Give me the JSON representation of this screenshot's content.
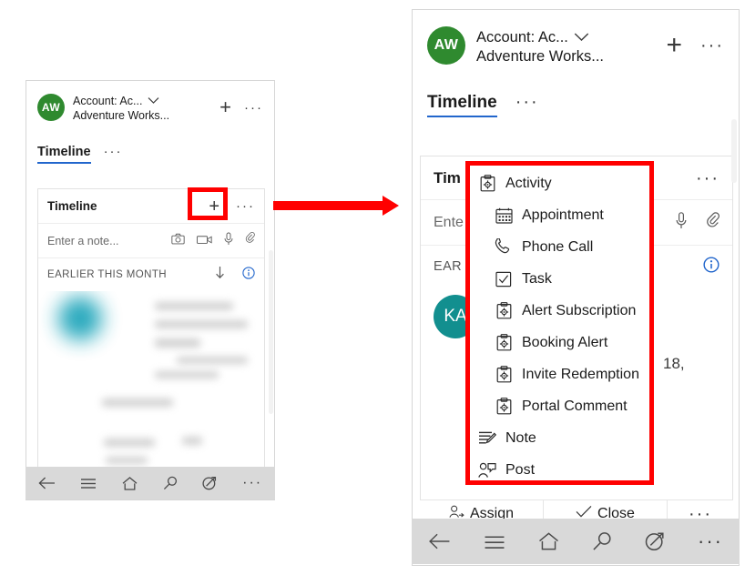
{
  "left_panel": {
    "account": {
      "avatar_initials": "AW",
      "title": "Account: Ac...",
      "subtitle": "Adventure Works...",
      "chevron": "chevron-down",
      "add_label": "+",
      "more_label": "···"
    },
    "tab": {
      "label": "Timeline",
      "more_label": "···"
    },
    "card": {
      "title": "Timeline",
      "add_label": "+",
      "more_label": "···",
      "note_placeholder": "Enter a note...",
      "note_icons": [
        "camera-icon",
        "video-icon",
        "microphone-icon",
        "attachment-icon"
      ],
      "section_label": "EARLIER THIS MONTH",
      "sort_icon": "arrow-down-icon",
      "info_icon": "info-icon"
    },
    "nav": {
      "items": [
        "back-icon",
        "menu-icon",
        "home-icon",
        "search-icon",
        "compass-icon",
        "more-icon"
      ]
    }
  },
  "right_panel": {
    "account": {
      "avatar_initials": "AW",
      "title": "Account: Ac...",
      "subtitle": "Adventure Works...",
      "chevron": "chevron-down",
      "add_label": "+",
      "more_label": "···"
    },
    "tab": {
      "label": "Timeline",
      "more_label": "···"
    },
    "card": {
      "title": "Tim",
      "more_label": "···",
      "note_placeholder": "Ente",
      "section_label": "EAR",
      "info_icon": "info-icon",
      "record_avatar_initials": "KA",
      "record_fragment": "18,"
    },
    "menu": {
      "items": [
        {
          "label": "Activity",
          "icon": "activity-icon",
          "indent": false
        },
        {
          "label": "Appointment",
          "icon": "calendar-icon",
          "indent": true
        },
        {
          "label": "Phone Call",
          "icon": "phone-icon",
          "indent": true
        },
        {
          "label": "Task",
          "icon": "task-icon",
          "indent": true
        },
        {
          "label": "Alert Subscription",
          "icon": "activity-icon",
          "indent": true
        },
        {
          "label": "Booking Alert",
          "icon": "activity-icon",
          "indent": true
        },
        {
          "label": "Invite Redemption",
          "icon": "activity-icon",
          "indent": true
        },
        {
          "label": "Portal Comment",
          "icon": "activity-icon",
          "indent": true
        },
        {
          "label": "Note",
          "icon": "note-icon",
          "indent": false
        },
        {
          "label": "Post",
          "icon": "post-icon",
          "indent": false
        }
      ]
    },
    "commandbar": {
      "assign_label": "Assign",
      "assign_icon": "assign-user-icon",
      "close_label": "Close",
      "close_icon": "check-icon",
      "more_label": "···"
    },
    "nav": {
      "items": [
        "back-icon",
        "menu-icon",
        "home-icon",
        "search-icon",
        "compass-icon",
        "more-icon"
      ]
    }
  },
  "annotations": {
    "highlight_add_button": "red-rectangle-around-add-button",
    "highlight_menu": "red-rectangle-around-menu",
    "arrow": "red-right-arrow"
  },
  "colors": {
    "accent_blue": "#2266cc",
    "avatar_green": "#2f8a2f",
    "avatar_teal": "#128f8f",
    "annotation_red": "#ff0000",
    "navbar_gray": "#d9d9d9"
  }
}
